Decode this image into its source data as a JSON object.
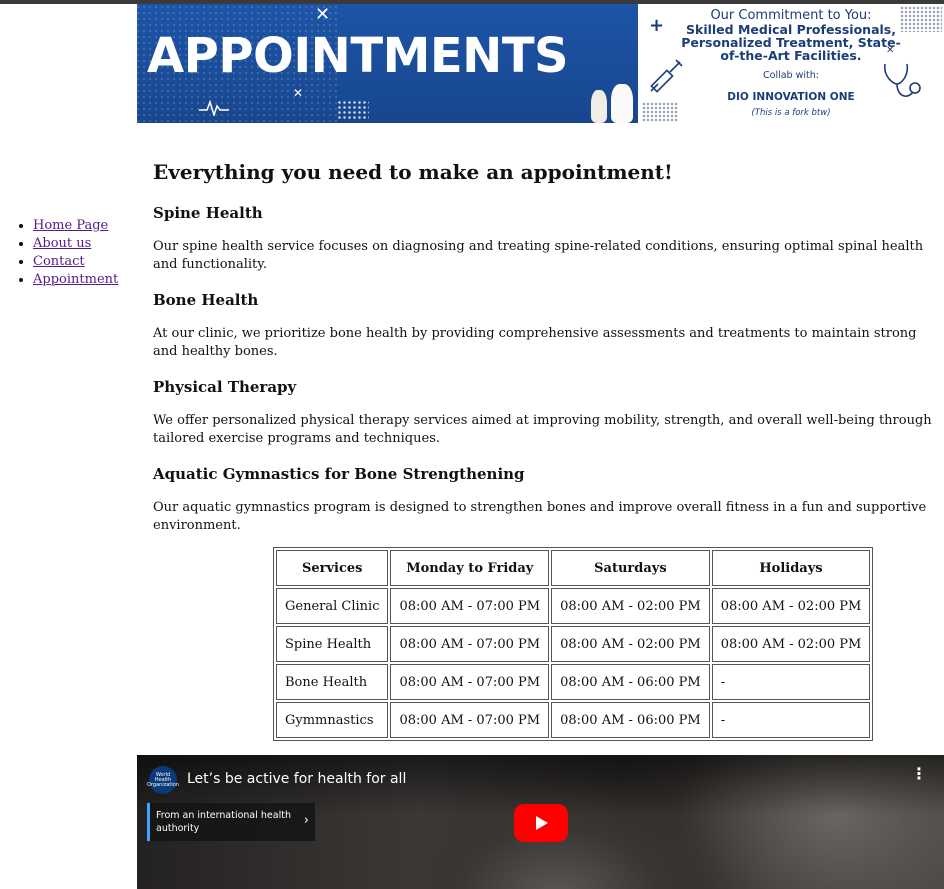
{
  "banner": {
    "title": "APPOINTMENTS",
    "commitment_title": "Our Commitment to You:",
    "commitment_line1": "Skilled Medical Professionals,",
    "commitment_line2": "Personalized Treatment, State-",
    "commitment_line3": "of-the-Art Facilities.",
    "collab_label": "Collab with:",
    "collab_name": "DIO INNOVATION ONE",
    "fork_note": "(This is a fork btw)",
    "colors": {
      "primary_blue": "#1d54a7",
      "text_blue": "#1b3d7a"
    }
  },
  "nav": {
    "items": [
      {
        "label": "Home Page"
      },
      {
        "label": "About us"
      },
      {
        "label": "Contact"
      },
      {
        "label": "Appointment"
      }
    ],
    "link_color": "#551a8b"
  },
  "main": {
    "heading": "Everything you need to make an appointment!",
    "sections": [
      {
        "title": "Spine Health",
        "text": "Our spine health service focuses on diagnosing and treating spine-related conditions, ensuring optimal spinal health and functionality."
      },
      {
        "title": "Bone Health",
        "text": "At our clinic, we prioritize bone health by providing comprehensive assessments and treatments to maintain strong and healthy bones."
      },
      {
        "title": "Physical Therapy",
        "text": "We offer personalized physical therapy services aimed at improving mobility, strength, and overall well-being through tailored exercise programs and techniques."
      },
      {
        "title": "Aquatic Gymnastics for Bone Strengthening",
        "text": "Our aquatic gymnastics program is designed to strengthen bones and improve overall fitness in a fun and supportive environment."
      }
    ]
  },
  "schedule": {
    "headers": [
      "Services",
      "Monday to Friday",
      "Saturdays",
      "Holidays"
    ],
    "rows": [
      [
        "General Clinic",
        "08:00 AM - 07:00 PM",
        "08:00 AM - 02:00 PM",
        "08:00 AM - 02:00 PM"
      ],
      [
        "Spine Health",
        "08:00 AM - 07:00 PM",
        "08:00 AM - 02:00 PM",
        "08:00 AM - 02:00 PM"
      ],
      [
        "Bone Health",
        "08:00 AM - 07:00 PM",
        "08:00 AM - 06:00 PM",
        "-"
      ],
      [
        "Gymmnastics",
        "08:00 AM - 07:00 PM",
        "08:00 AM - 06:00 PM",
        "-"
      ]
    ]
  },
  "video": {
    "channel_logo_text": "World Health Organization",
    "title": "Let’s be active for health for all",
    "info_panel": "From an international health authority",
    "play_color": "#ff0000",
    "icons": [
      "who-logo-icon",
      "more-vert-icon",
      "chevron-right-icon",
      "play-icon"
    ]
  }
}
